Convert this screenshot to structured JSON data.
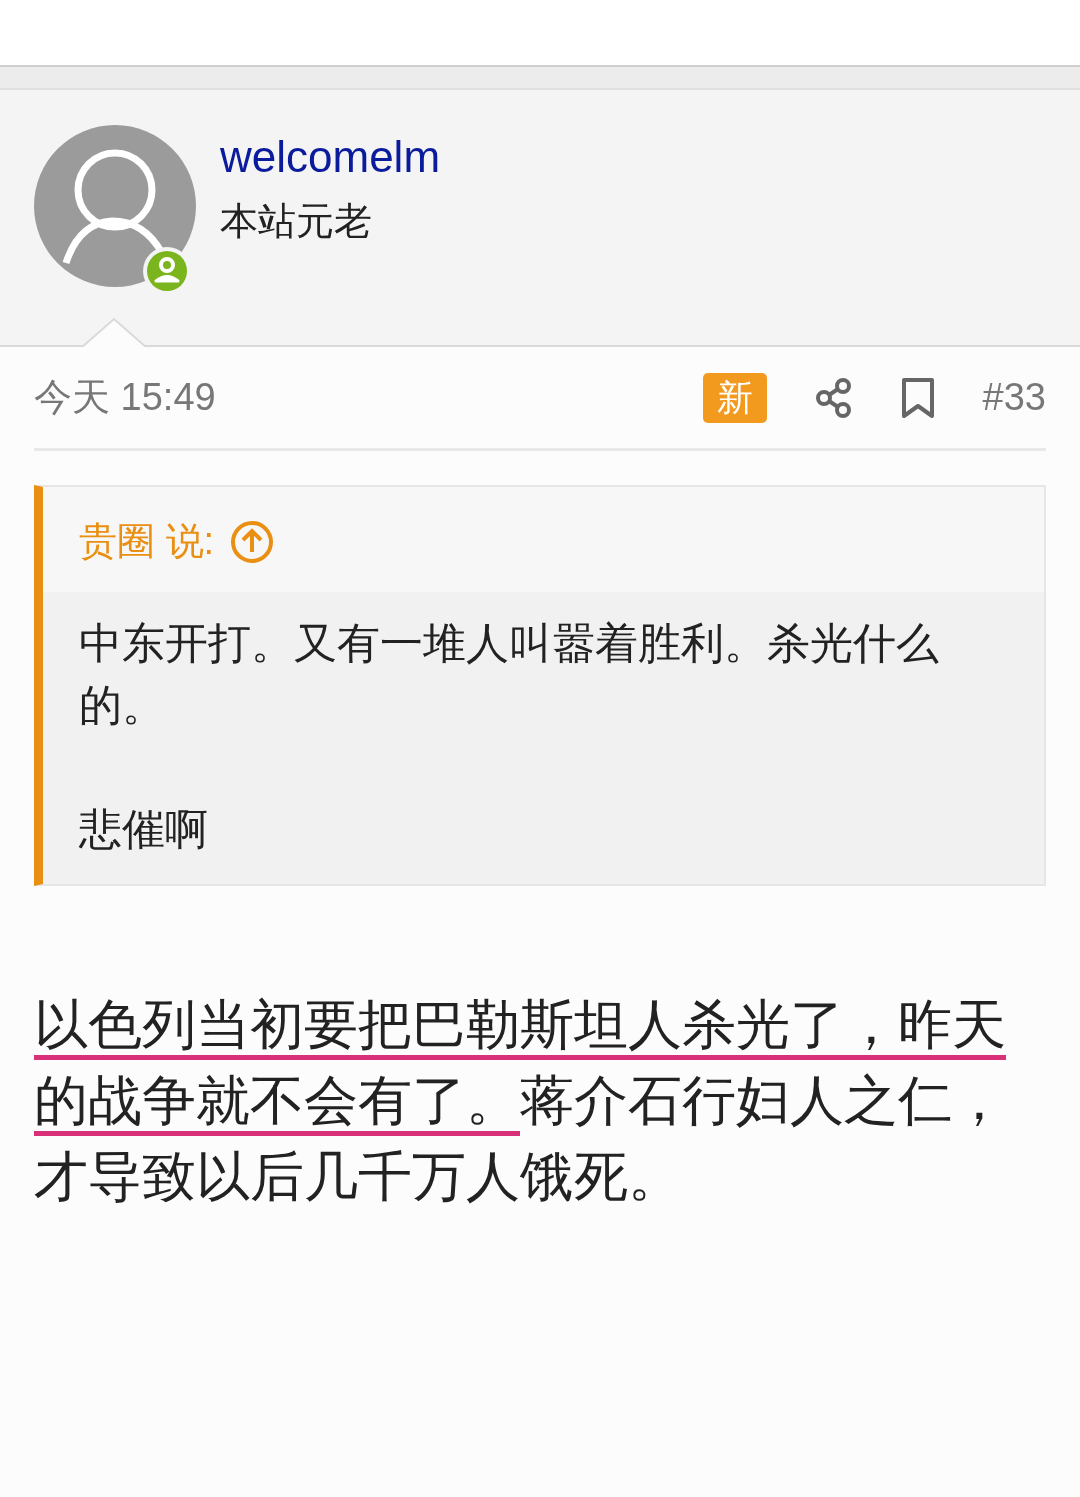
{
  "post": {
    "author": {
      "name": "welcomelm",
      "title": "本站元老",
      "online": true
    },
    "time": "今天 15:49",
    "new_badge": "新",
    "post_number": "#33",
    "quote": {
      "author": "贵圈 说:",
      "paragraphs": [
        "中东开打。又有一堆人叫嚣着胜利。杀光什么的。",
        "悲催啊"
      ]
    },
    "body": [
      {
        "text": "以色列当初要把巴勒斯坦人杀光了，昨天的战争就不会有了。",
        "underlined": true
      },
      {
        "text": "蒋介石行妇人之仁，才导致以后几千万人饿死。",
        "underlined": false
      }
    ]
  }
}
